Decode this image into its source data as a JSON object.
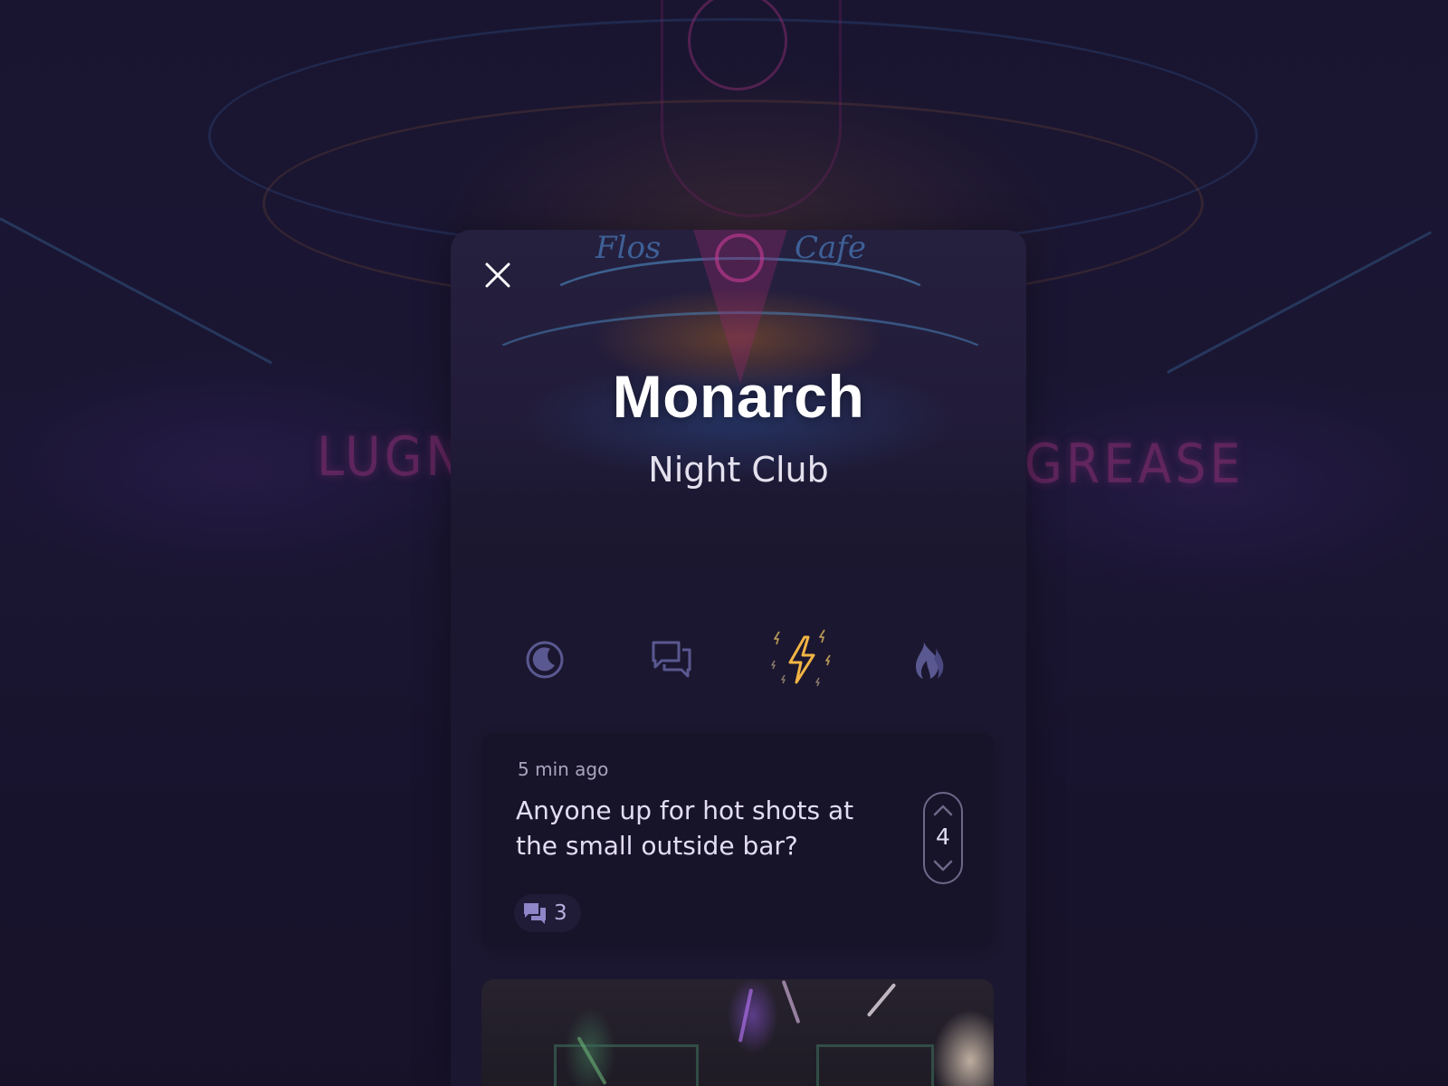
{
  "venue": {
    "name": "Monarch",
    "category": "Night Club"
  },
  "tabs": [
    {
      "name": "tab-night",
      "icon": "moon-icon",
      "active": false
    },
    {
      "name": "tab-chat",
      "icon": "chat-bubbles-icon",
      "active": false
    },
    {
      "name": "tab-energy",
      "icon": "lightning-icon",
      "active": true
    },
    {
      "name": "tab-hot",
      "icon": "flame-icon",
      "active": false
    }
  ],
  "post": {
    "time": "5 min ago",
    "text": "Anyone up for hot shots at the small outside bar?",
    "votes": "4",
    "comments": "3"
  },
  "background_signs": {
    "left": "LUGNUT",
    "right": "GREASE",
    "top_left": "Flos",
    "top_right": "Cafe"
  },
  "colors": {
    "accent_active": "#f2b544",
    "icon_inactive": "#5a5890",
    "card_bg": "#1b1730"
  }
}
